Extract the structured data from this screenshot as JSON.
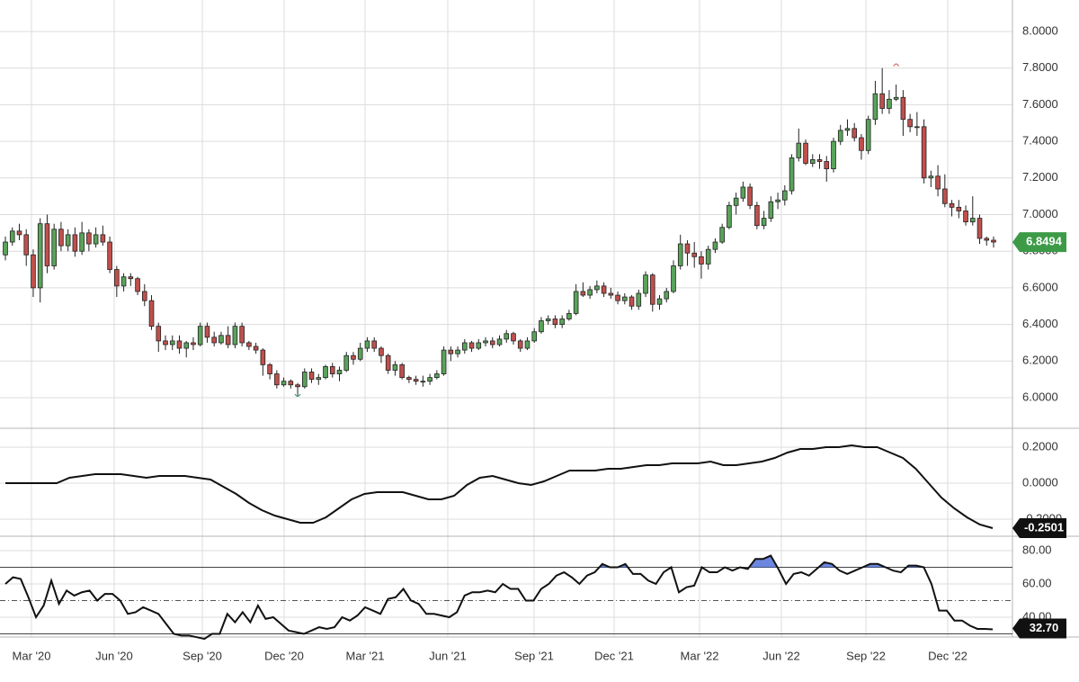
{
  "chart_data": [
    {
      "type": "candlestick",
      "price_axis": {
        "ticks": [
          "6.0000",
          "6.2000",
          "6.4000",
          "6.6000",
          "6.8000",
          "7.0000",
          "7.2000",
          "7.4000",
          "7.6000",
          "7.8000",
          "8.0000"
        ],
        "ylim": [
          5.84,
          8.08
        ]
      },
      "last_value": "6.8494",
      "last_value_color": "#3d9b48",
      "up_color": "#5aa35a",
      "down_color": "#c0504d",
      "x_ticks": [
        "Mar '20",
        "Jun '20",
        "Sep '20",
        "Dec '20",
        "Mar '21",
        "Jun '21",
        "Sep '21",
        "Dec '21",
        "Mar '22",
        "Jun '22",
        "Sep '22",
        "Dec '22"
      ],
      "candles": [
        [
          6.78,
          6.85,
          6.88,
          6.75
        ],
        [
          6.85,
          6.91,
          6.93,
          6.83
        ],
        [
          6.91,
          6.89,
          6.95,
          6.86
        ],
        [
          6.89,
          6.78,
          6.92,
          6.72
        ],
        [
          6.78,
          6.6,
          6.81,
          6.55
        ],
        [
          6.6,
          6.95,
          6.98,
          6.52
        ],
        [
          6.95,
          6.72,
          7.0,
          6.68
        ],
        [
          6.72,
          6.92,
          6.95,
          6.7
        ],
        [
          6.92,
          6.83,
          6.96,
          6.8
        ],
        [
          6.83,
          6.89,
          6.92,
          6.8
        ],
        [
          6.89,
          6.8,
          6.93,
          6.77
        ],
        [
          6.8,
          6.9,
          6.96,
          6.78
        ],
        [
          6.9,
          6.84,
          6.92,
          6.8
        ],
        [
          6.84,
          6.89,
          6.93,
          6.82
        ],
        [
          6.89,
          6.85,
          6.94,
          6.83
        ],
        [
          6.85,
          6.7,
          6.88,
          6.68
        ],
        [
          6.7,
          6.61,
          6.72,
          6.55
        ],
        [
          6.61,
          6.66,
          6.68,
          6.58
        ],
        [
          6.66,
          6.65,
          6.68,
          6.61
        ],
        [
          6.65,
          6.58,
          6.66,
          6.56
        ],
        [
          6.58,
          6.53,
          6.62,
          6.5
        ],
        [
          6.53,
          6.39,
          6.56,
          6.37
        ],
        [
          6.39,
          6.31,
          6.41,
          6.25
        ],
        [
          6.31,
          6.29,
          6.34,
          6.26
        ],
        [
          6.29,
          6.31,
          6.34,
          6.26
        ],
        [
          6.31,
          6.27,
          6.34,
          6.24
        ],
        [
          6.27,
          6.3,
          6.31,
          6.22
        ],
        [
          6.3,
          6.29,
          6.33,
          6.26
        ],
        [
          6.29,
          6.39,
          6.41,
          6.28
        ],
        [
          6.39,
          6.33,
          6.41,
          6.3
        ],
        [
          6.33,
          6.3,
          6.36,
          6.28
        ],
        [
          6.3,
          6.34,
          6.36,
          6.29
        ],
        [
          6.34,
          6.29,
          6.39,
          6.27
        ],
        [
          6.29,
          6.39,
          6.41,
          6.27
        ],
        [
          6.39,
          6.3,
          6.41,
          6.28
        ],
        [
          6.3,
          6.28,
          6.31,
          6.26
        ],
        [
          6.28,
          6.26,
          6.3,
          6.24
        ],
        [
          6.26,
          6.18,
          6.27,
          6.12
        ],
        [
          6.18,
          6.13,
          6.19,
          6.1
        ],
        [
          6.13,
          6.07,
          6.15,
          6.05
        ],
        [
          6.07,
          6.09,
          6.11,
          6.06
        ],
        [
          6.09,
          6.07,
          6.1,
          6.05
        ],
        [
          6.07,
          6.06,
          6.08,
          6.01
        ],
        [
          6.06,
          6.14,
          6.16,
          6.05
        ],
        [
          6.14,
          6.1,
          6.16,
          6.08
        ],
        [
          6.1,
          6.11,
          6.13,
          6.07
        ],
        [
          6.11,
          6.17,
          6.18,
          6.1
        ],
        [
          6.17,
          6.13,
          6.19,
          6.11
        ],
        [
          6.13,
          6.15,
          6.17,
          6.09
        ],
        [
          6.15,
          6.23,
          6.25,
          6.14
        ],
        [
          6.23,
          6.21,
          6.25,
          6.18
        ],
        [
          6.21,
          6.27,
          6.3,
          6.2
        ],
        [
          6.27,
          6.31,
          6.33,
          6.25
        ],
        [
          6.31,
          6.27,
          6.33,
          6.25
        ],
        [
          6.27,
          6.23,
          6.28,
          6.19
        ],
        [
          6.23,
          6.15,
          6.24,
          6.13
        ],
        [
          6.15,
          6.18,
          6.2,
          6.12
        ],
        [
          6.18,
          6.11,
          6.19,
          6.1
        ],
        [
          6.11,
          6.1,
          6.12,
          6.08
        ],
        [
          6.1,
          6.09,
          6.12,
          6.07
        ],
        [
          6.09,
          6.09,
          6.12,
          6.06
        ],
        [
          6.09,
          6.11,
          6.13,
          6.07
        ],
        [
          6.11,
          6.13,
          6.15,
          6.1
        ],
        [
          6.13,
          6.26,
          6.28,
          6.12
        ],
        [
          6.26,
          6.24,
          6.28,
          6.2
        ],
        [
          6.24,
          6.26,
          6.28,
          6.22
        ],
        [
          6.26,
          6.3,
          6.32,
          6.24
        ],
        [
          6.3,
          6.27,
          6.31,
          6.25
        ],
        [
          6.27,
          6.3,
          6.32,
          6.26
        ],
        [
          6.3,
          6.31,
          6.33,
          6.28
        ],
        [
          6.31,
          6.29,
          6.33,
          6.27
        ],
        [
          6.29,
          6.32,
          6.34,
          6.28
        ],
        [
          6.32,
          6.35,
          6.37,
          6.3
        ],
        [
          6.35,
          6.31,
          6.36,
          6.29
        ],
        [
          6.31,
          6.27,
          6.32,
          6.25
        ],
        [
          6.27,
          6.31,
          6.33,
          6.26
        ],
        [
          6.31,
          6.36,
          6.38,
          6.3
        ],
        [
          6.36,
          6.42,
          6.44,
          6.35
        ],
        [
          6.42,
          6.43,
          6.45,
          6.4
        ],
        [
          6.43,
          6.4,
          6.45,
          6.38
        ],
        [
          6.4,
          6.43,
          6.45,
          6.38
        ],
        [
          6.43,
          6.46,
          6.48,
          6.42
        ],
        [
          6.46,
          6.58,
          6.62,
          6.45
        ],
        [
          6.58,
          6.56,
          6.63,
          6.55
        ],
        [
          6.56,
          6.59,
          6.61,
          6.54
        ],
        [
          6.59,
          6.61,
          6.64,
          6.57
        ],
        [
          6.61,
          6.57,
          6.63,
          6.55
        ],
        [
          6.57,
          6.56,
          6.6,
          6.54
        ],
        [
          6.56,
          6.53,
          6.58,
          6.51
        ],
        [
          6.53,
          6.55,
          6.57,
          6.51
        ],
        [
          6.55,
          6.5,
          6.56,
          6.48
        ],
        [
          6.5,
          6.57,
          6.59,
          6.48
        ],
        [
          6.57,
          6.67,
          6.69,
          6.55
        ],
        [
          6.67,
          6.51,
          6.68,
          6.47
        ],
        [
          6.51,
          6.54,
          6.56,
          6.48
        ],
        [
          6.54,
          6.58,
          6.6,
          6.52
        ],
        [
          6.58,
          6.72,
          6.75,
          6.57
        ],
        [
          6.72,
          6.84,
          6.89,
          6.7
        ],
        [
          6.84,
          6.79,
          6.86,
          6.72
        ],
        [
          6.79,
          6.77,
          6.85,
          6.71
        ],
        [
          6.77,
          6.73,
          6.8,
          6.65
        ],
        [
          6.73,
          6.81,
          6.83,
          6.7
        ],
        [
          6.81,
          6.85,
          6.87,
          6.79
        ],
        [
          6.85,
          6.93,
          6.95,
          6.84
        ],
        [
          6.93,
          7.05,
          7.07,
          6.92
        ],
        [
          7.05,
          7.09,
          7.12,
          7.0
        ],
        [
          7.09,
          7.15,
          7.18,
          7.07
        ],
        [
          7.15,
          7.05,
          7.17,
          7.03
        ],
        [
          7.05,
          6.94,
          7.07,
          6.92
        ],
        [
          6.94,
          6.98,
          7.02,
          6.92
        ],
        [
          6.98,
          7.07,
          7.1,
          6.96
        ],
        [
          7.07,
          7.08,
          7.12,
          7.03
        ],
        [
          7.08,
          7.13,
          7.16,
          7.05
        ],
        [
          7.13,
          7.31,
          7.33,
          7.11
        ],
        [
          7.31,
          7.39,
          7.47,
          7.29
        ],
        [
          7.39,
          7.28,
          7.41,
          7.27
        ],
        [
          7.28,
          7.3,
          7.33,
          7.26
        ],
        [
          7.3,
          7.29,
          7.33,
          7.25
        ],
        [
          7.29,
          7.25,
          7.32,
          7.18
        ],
        [
          7.25,
          7.4,
          7.42,
          7.23
        ],
        [
          7.4,
          7.46,
          7.49,
          7.38
        ],
        [
          7.46,
          7.47,
          7.52,
          7.43
        ],
        [
          7.47,
          7.42,
          7.5,
          7.4
        ],
        [
          7.42,
          7.35,
          7.44,
          7.3
        ],
        [
          7.35,
          7.52,
          7.54,
          7.33
        ],
        [
          7.52,
          7.66,
          7.73,
          7.49
        ],
        [
          7.66,
          7.58,
          7.8,
          7.55
        ],
        [
          7.58,
          7.63,
          7.68,
          7.55
        ],
        [
          7.63,
          7.64,
          7.71,
          7.62
        ],
        [
          7.64,
          7.52,
          7.68,
          7.43
        ],
        [
          7.52,
          7.48,
          7.55,
          7.45
        ],
        [
          7.48,
          7.48,
          7.56,
          7.43
        ],
        [
          7.48,
          7.2,
          7.52,
          7.17
        ],
        [
          7.2,
          7.21,
          7.24,
          7.15
        ],
        [
          7.21,
          7.14,
          7.27,
          7.1
        ],
        [
          7.14,
          7.06,
          7.22,
          7.04
        ],
        [
          7.06,
          7.04,
          7.08,
          6.99
        ],
        [
          7.04,
          7.02,
          7.08,
          6.98
        ],
        [
          7.02,
          6.96,
          7.05,
          6.94
        ],
        [
          6.96,
          6.98,
          7.1,
          6.94
        ],
        [
          6.98,
          6.87,
          7.0,
          6.84
        ],
        [
          6.87,
          6.86,
          6.88,
          6.83
        ],
        [
          6.86,
          6.85,
          6.88,
          6.82
        ]
      ],
      "markers": [
        {
          "label": "^",
          "value": 7.82,
          "candle": 128,
          "color": "#d07070"
        },
        {
          "label": "v",
          "value": 6.01,
          "candle": 42,
          "color": "#4a9a8a"
        }
      ]
    },
    {
      "type": "line",
      "axis": {
        "ticks": [
          "-0.2000",
          "0.0000",
          "0.2000"
        ],
        "ylim": [
          -0.3,
          0.3
        ]
      },
      "last_value": "-0.2501",
      "line_color": "#111111",
      "values": [
        0.0,
        0.0,
        0.0,
        0.0,
        0.0,
        0.03,
        0.04,
        0.05,
        0.05,
        0.05,
        0.04,
        0.03,
        0.04,
        0.04,
        0.04,
        0.03,
        0.02,
        -0.02,
        -0.06,
        -0.11,
        -0.15,
        -0.18,
        -0.2,
        -0.22,
        -0.22,
        -0.19,
        -0.14,
        -0.09,
        -0.06,
        -0.05,
        -0.05,
        -0.05,
        -0.07,
        -0.09,
        -0.09,
        -0.07,
        -0.01,
        0.03,
        0.04,
        0.02,
        0.0,
        -0.01,
        0.01,
        0.04,
        0.07,
        0.07,
        0.07,
        0.08,
        0.08,
        0.09,
        0.1,
        0.1,
        0.11,
        0.11,
        0.11,
        0.12,
        0.1,
        0.1,
        0.11,
        0.12,
        0.14,
        0.17,
        0.19,
        0.19,
        0.2,
        0.2,
        0.21,
        0.2,
        0.2,
        0.17,
        0.14,
        0.08,
        0.0,
        -0.08,
        -0.14,
        -0.19,
        -0.23,
        -0.2501
      ]
    },
    {
      "type": "line",
      "axis": {
        "ticks": [
          "40.00",
          "60.00",
          "80.00"
        ],
        "ylim": [
          20,
          90
        ]
      },
      "reference_levels": [
        70,
        50,
        30
      ],
      "last_value": "32.70",
      "line_color": "#111111",
      "fill_color": "#3b5fd4",
      "values": [
        60,
        64,
        63,
        52,
        40,
        47,
        62,
        48,
        56,
        53,
        55,
        56,
        50,
        54,
        54,
        50,
        42,
        43,
        46,
        44,
        42,
        36,
        30,
        29,
        29,
        28,
        27,
        30,
        30,
        42,
        37,
        43,
        37,
        47,
        39,
        40,
        36,
        32,
        31,
        30,
        32,
        34,
        33,
        34,
        40,
        38,
        41,
        46,
        44,
        42,
        51,
        52,
        57,
        50,
        48,
        42,
        42,
        41,
        40,
        43,
        53,
        55,
        55,
        56,
        55,
        60,
        57,
        57,
        50,
        50,
        57,
        60,
        65,
        67,
        64,
        60,
        65,
        67,
        72,
        70,
        70,
        72,
        66,
        66,
        62,
        60,
        67,
        70,
        55,
        58,
        59,
        70,
        67,
        67,
        70,
        68,
        70,
        69,
        75,
        75,
        77,
        69,
        60,
        66,
        67,
        65,
        69,
        73,
        72,
        68,
        66,
        68,
        70,
        72,
        72,
        70,
        68,
        67,
        71,
        71,
        70,
        60,
        44,
        44,
        38,
        38,
        35,
        33,
        33,
        32.7
      ]
    }
  ]
}
